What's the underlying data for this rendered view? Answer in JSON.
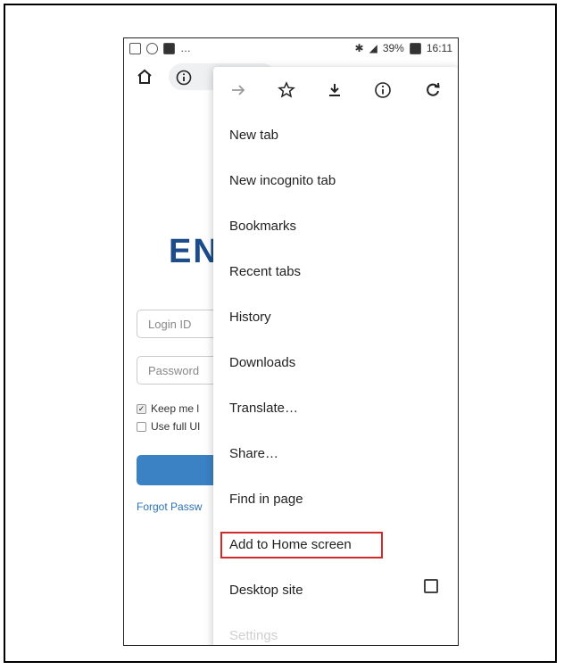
{
  "statusbar": {
    "battery": "39%",
    "time": "16:11",
    "more_dots": "…"
  },
  "page": {
    "logo_text": "EN",
    "login_placeholder": "Login ID",
    "password_placeholder": "Password",
    "keep_me_label": "Keep me l",
    "use_full_label": "Use full UI",
    "forgot_label": "Forgot Passw"
  },
  "menu": {
    "items": [
      "New tab",
      "New incognito tab",
      "Bookmarks",
      "Recent tabs",
      "History",
      "Downloads",
      "Translate…",
      "Share…",
      "Find in page",
      "Add to Home screen",
      "Desktop site",
      "Settings"
    ],
    "highlighted_item": "Add to Home screen"
  },
  "colors": {
    "highlight_border": "#d12a2a",
    "logo": "#1c4c8a",
    "button": "#3b82c4"
  }
}
